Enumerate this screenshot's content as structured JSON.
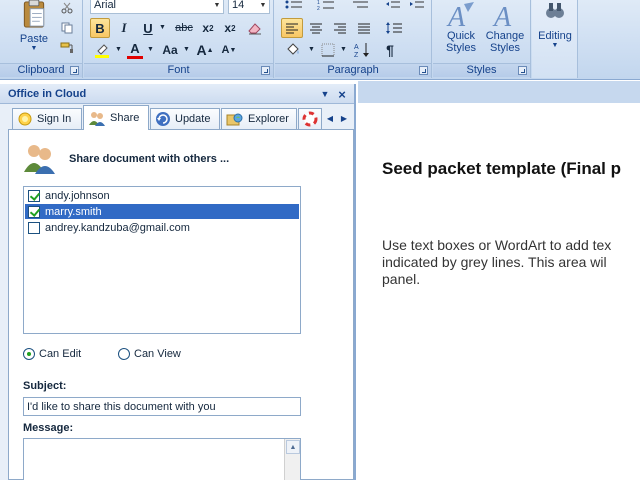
{
  "ribbon": {
    "clipboard": {
      "label": "Clipboard",
      "paste_label": "Paste"
    },
    "font": {
      "label": "Font",
      "font_name": "Arial",
      "font_size": "14",
      "bold": "B",
      "italic": "I",
      "underline": "U",
      "strike": "abc",
      "subscript": "x",
      "sub_mark": "2",
      "superscript": "x",
      "sup_mark": "2",
      "font_color": "A",
      "change_case": "Aa",
      "grow": "A",
      "shrink": "A"
    },
    "paragraph": {
      "label": "Paragraph",
      "pilcrow": "¶"
    },
    "styles": {
      "label": "Styles",
      "quick_styles": "Quick Styles",
      "change_styles": "Change Styles"
    },
    "editing": {
      "label": "Editing"
    }
  },
  "pane": {
    "title": "Office in Cloud",
    "tabs": [
      {
        "label": "Sign In"
      },
      {
        "label": "Share"
      },
      {
        "label": "Update"
      },
      {
        "label": "Explorer"
      }
    ],
    "share": {
      "heading": "Share document with others ...",
      "users": [
        {
          "name": "andy.johnson",
          "checked": true,
          "selected": false
        },
        {
          "name": "marry.smith",
          "checked": true,
          "selected": true
        },
        {
          "name": "andrey.kandzuba@gmail.com",
          "checked": false,
          "selected": false
        }
      ],
      "permissions": [
        {
          "label": "Can Edit",
          "selected": true
        },
        {
          "label": "Can View",
          "selected": false
        }
      ],
      "subject_label": "Subject:",
      "subject_value": "I'd like to share this document with you",
      "message_label": "Message:",
      "message_value": ""
    }
  },
  "document": {
    "title": "Seed packet template (Final p",
    "body_lines": [
      "Use text boxes or WordArt to add tex",
      "indicated by grey lines. This area wil",
      "panel."
    ]
  },
  "colors": {
    "accent": "#316ac5",
    "check": "#21a121",
    "ribbon_text": "#15428b"
  }
}
